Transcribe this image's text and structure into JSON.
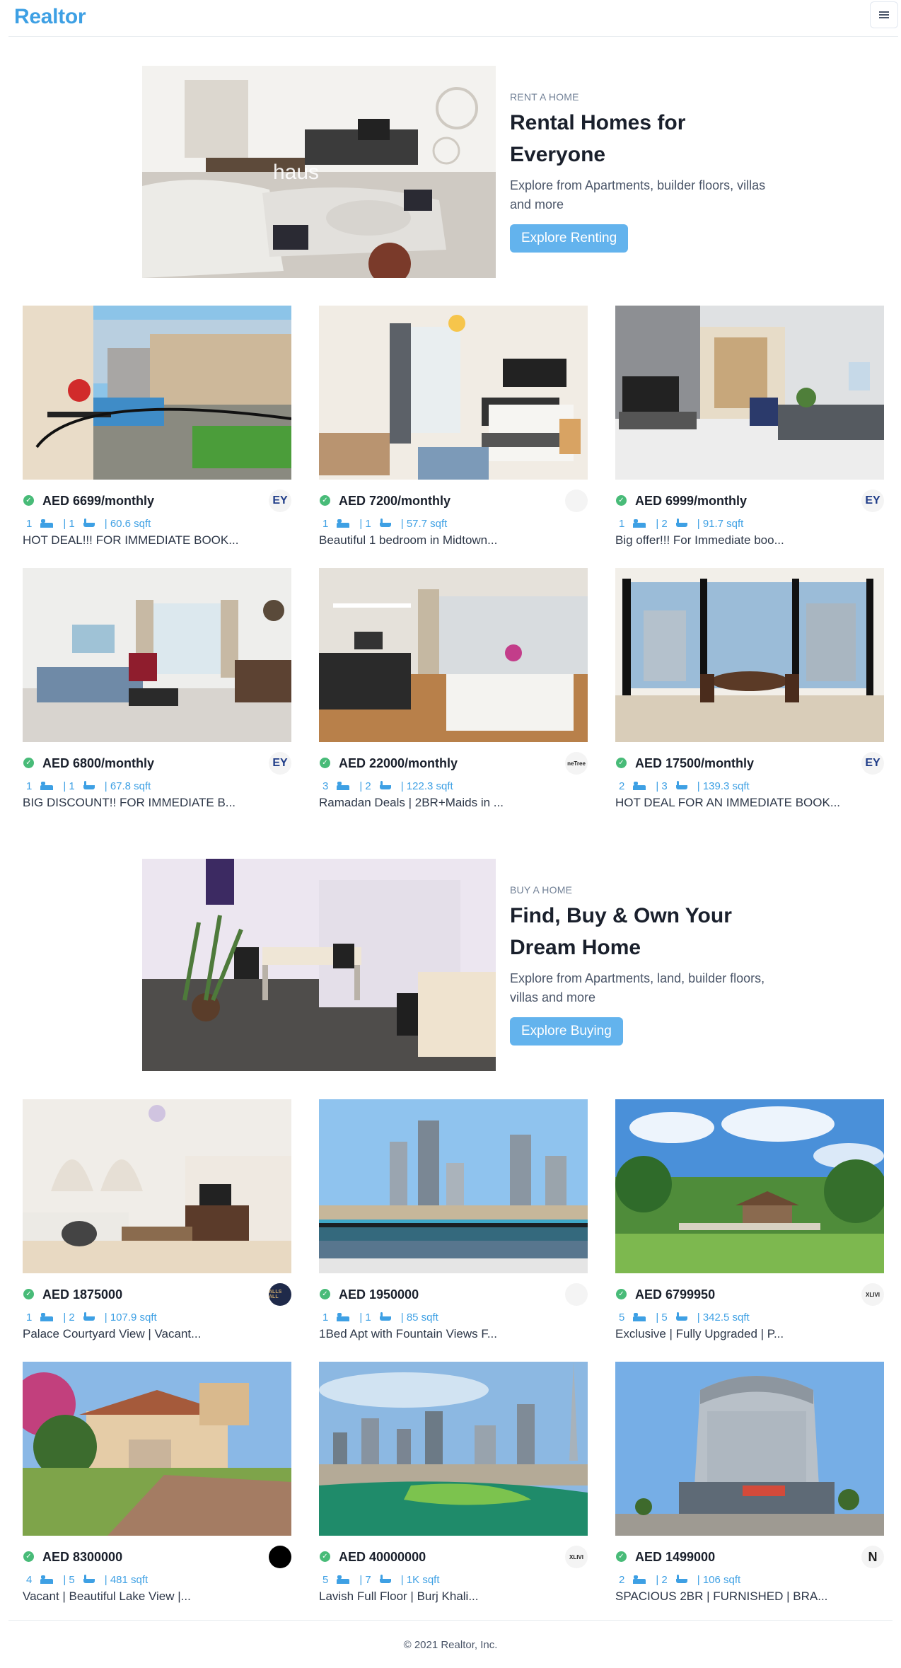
{
  "nav": {
    "brand": "Realtor",
    "menu_icon": "hamburger-icon"
  },
  "rent_banner": {
    "purpose": "RENT A HOME",
    "title_line1": "Rental Homes for",
    "title_line2": "Everyone",
    "desc": "Explore from Apartments, builder floors, villas and more",
    "button": "Explore Renting"
  },
  "rent_properties": [
    {
      "price": "AED 6699/monthly",
      "rooms": "1",
      "baths": "| 1",
      "area": "| 60.6 sqft",
      "title": "HOT DEAL!!! FOR IMMEDIATE BOOK...",
      "agency": "EY"
    },
    {
      "price": "AED 7200/monthly",
      "rooms": "1",
      "baths": "| 1",
      "area": "| 57.7 sqft",
      "title": "Beautiful 1 bedroom in Midtown...",
      "agency": ""
    },
    {
      "price": "AED 6999/monthly",
      "rooms": "1",
      "baths": "| 2",
      "area": "| 91.7 sqft",
      "title": "Big offer!!! For Immediate boo...",
      "agency": "EY"
    },
    {
      "price": "AED 6800/monthly",
      "rooms": "1",
      "baths": "| 1",
      "area": "| 67.8 sqft",
      "title": "BIG DISCOUNT!! FOR IMMEDIATE B...",
      "agency": "EY"
    },
    {
      "price": "AED 22000/monthly",
      "rooms": "3",
      "baths": "| 2",
      "area": "| 122.3 sqft",
      "title": "Ramadan Deals | 2BR+Maids in ...",
      "agency": "neTree"
    },
    {
      "price": "AED 17500/monthly",
      "rooms": "2",
      "baths": "| 3",
      "area": "| 139.3 sqft",
      "title": "HOT DEAL FOR AN IMMEDIATE BOOK...",
      "agency": "EY"
    }
  ],
  "buy_banner": {
    "purpose": "BUY A HOME",
    "title_line1": "Find, Buy & Own Your",
    "title_line2": "Dream Home",
    "desc": "Explore from Apartments, land, builder floors, villas and more",
    "button": "Explore Buying"
  },
  "sale_properties": [
    {
      "price": "AED 1875000",
      "rooms": "1",
      "baths": "| 2",
      "area": "| 107.9 sqft",
      "title": "Palace Courtyard View | Vacant...",
      "agency": "ALLS ALL"
    },
    {
      "price": "AED 1950000",
      "rooms": "1",
      "baths": "| 1",
      "area": "| 85 sqft",
      "title": "1Bed Apt with Fountain Views F...",
      "agency": ""
    },
    {
      "price": "AED 6799950",
      "rooms": "5",
      "baths": "| 5",
      "area": "| 342.5 sqft",
      "title": "Exclusive | Fully Upgraded | P...",
      "agency": "XLIVI"
    },
    {
      "price": "AED 8300000",
      "rooms": "4",
      "baths": "| 5",
      "area": "| 481 sqft",
      "title": "Vacant | Beautiful Lake View |...",
      "agency": ""
    },
    {
      "price": "AED 40000000",
      "rooms": "5",
      "baths": "| 7",
      "area": "| 1K sqft",
      "title": "Lavish Full Floor | Burj Khali...",
      "agency": "XLIVI"
    },
    {
      "price": "AED 1499000",
      "rooms": "2",
      "baths": "| 2",
      "area": "| 106 sqft",
      "title": "SPACIOUS 2BR | FURNISHED | BRA...",
      "agency": "N"
    }
  ],
  "footer": {
    "text": "© 2021 Realtor, Inc."
  },
  "colors": {
    "brand": "#3ea0e4",
    "button": "#63b3ed",
    "verified": "#48bb78"
  }
}
